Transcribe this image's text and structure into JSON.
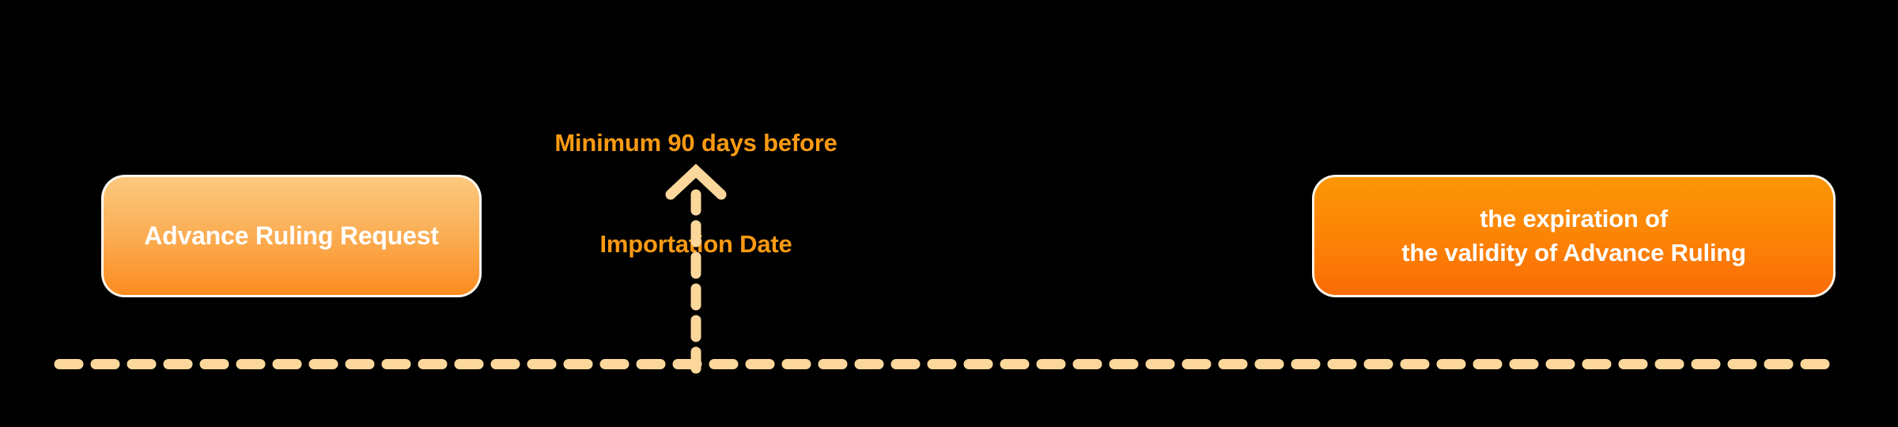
{
  "diagram": {
    "title_visible": false,
    "background_color": "#000000",
    "annotation": {
      "lines": [
        "Minimum 90 days before",
        "Importation Date"
      ],
      "color": "#FA9A12"
    },
    "nodes": [
      {
        "id": "advance-ruling-request",
        "lines": [
          "Advance Ruling Request"
        ],
        "fill_top": "#FCC97F",
        "fill_bottom": "#FC8C1F",
        "text_color": "#FFFFFF",
        "border_color": "#FFFFFF"
      },
      {
        "id": "expiration-of-validity",
        "lines": [
          "the expiration of",
          "the validity of Advance Ruling"
        ],
        "fill_top": "#FB9606",
        "fill_bottom": "#FA6C08",
        "text_color": "#FFFFFF",
        "border_color": "#FFFFFF"
      }
    ],
    "connectors": {
      "timeline": {
        "name": "dashed-timeline-axis",
        "style": "dashed",
        "color": "#FBD79B",
        "orientation": "horizontal"
      },
      "arrow": {
        "name": "dashed-up-arrow",
        "style": "dashed",
        "color": "#FBD79B",
        "direction": "up"
      }
    }
  }
}
